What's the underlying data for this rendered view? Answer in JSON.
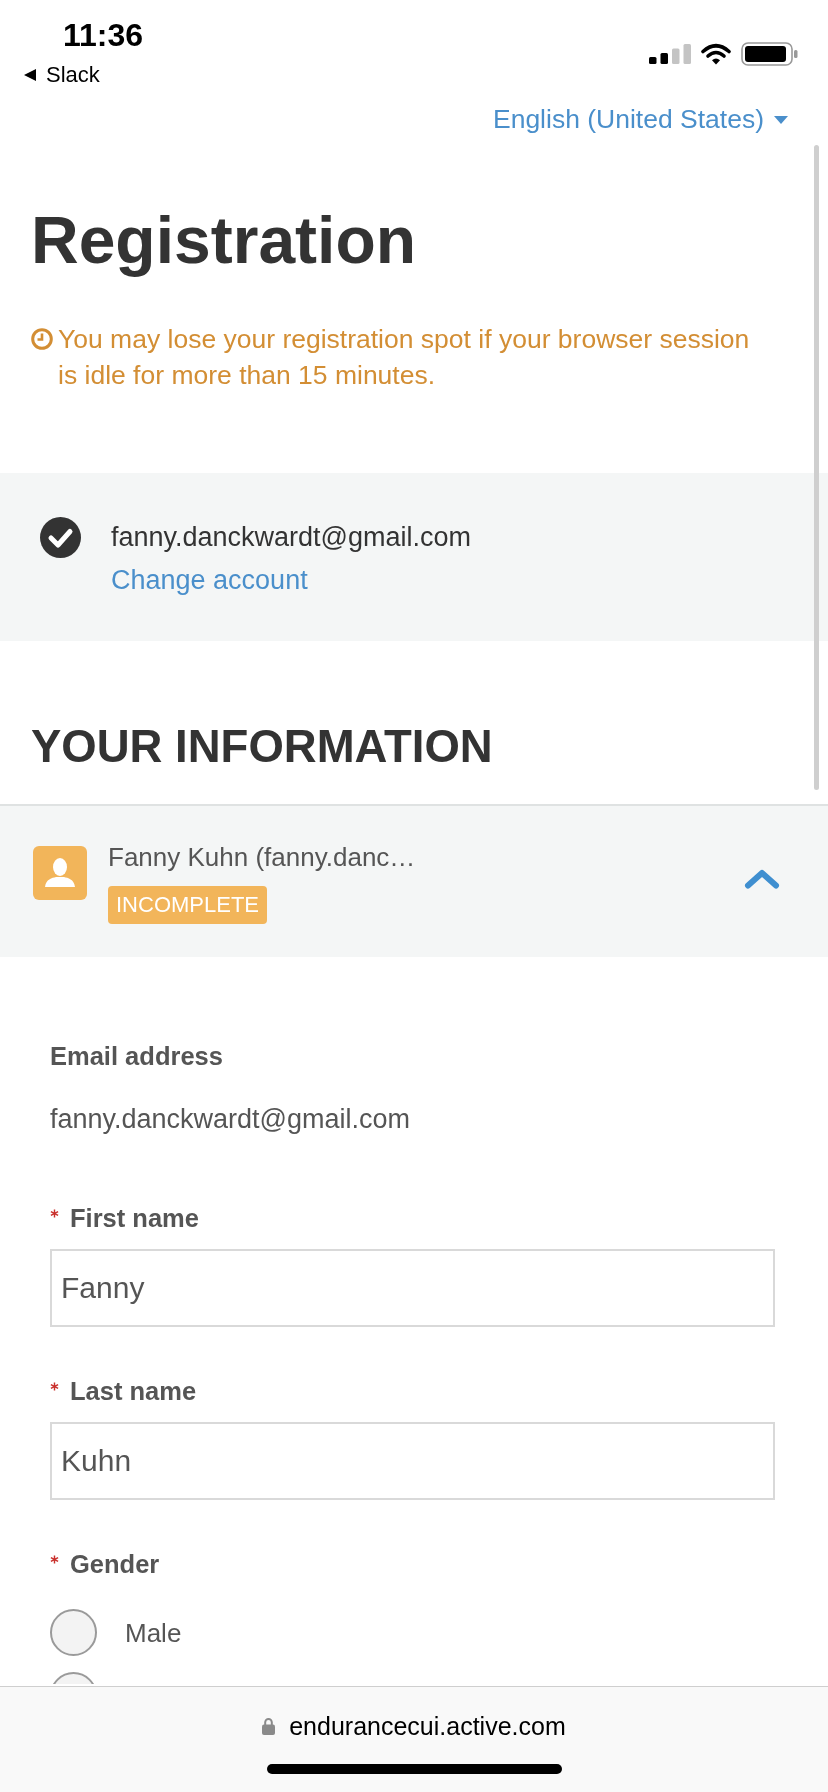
{
  "status_bar": {
    "time": "11:36",
    "back_app": "Slack"
  },
  "language_selector": {
    "label": "English (United States)"
  },
  "page_title": "Registration",
  "session_warning": "You may lose your registration spot if your browser session is idle for more than 15 minutes.",
  "account": {
    "verified": true,
    "email": "fanny.danckwardt@gmail.com",
    "change_link": "Change account"
  },
  "section_title": "YOUR INFORMATION",
  "participant": {
    "name": "Fanny Kuhn (fanny.danc…",
    "status": "INCOMPLETE",
    "expanded": true
  },
  "form": {
    "fields": [
      {
        "kind": "static",
        "required": false,
        "label": "Email address",
        "value": "fanny.danckwardt@gmail.com"
      },
      {
        "kind": "text",
        "required": true,
        "label": "First name",
        "value": "Fanny"
      },
      {
        "kind": "text",
        "required": true,
        "label": "Last name",
        "value": "Kuhn"
      },
      {
        "kind": "radio",
        "required": true,
        "label": "Gender",
        "options": [
          {
            "label": "Male",
            "selected": false
          },
          {
            "selected": false
          }
        ]
      }
    ]
  },
  "browser_bar": {
    "secure": true,
    "url": "endurancecui.active.com"
  }
}
